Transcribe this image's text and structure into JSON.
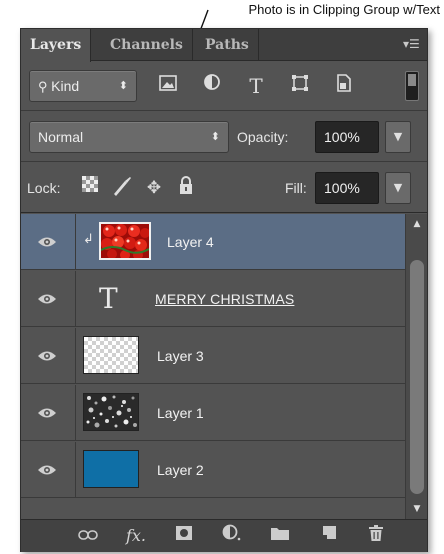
{
  "annotation": {
    "text": "Photo is in Clipping Group w/Text"
  },
  "tabs": [
    {
      "label": "Layers",
      "active": true
    },
    {
      "label": "Channels",
      "active": false
    },
    {
      "label": "Paths",
      "active": false
    }
  ],
  "filter": {
    "kind_label": "Kind",
    "icons": [
      "image-filter-icon",
      "adjustment-filter-icon",
      "type-filter-icon",
      "shape-filter-icon",
      "smart-object-filter-icon"
    ]
  },
  "blend": {
    "mode": "Normal",
    "opacity_label": "Opacity:",
    "opacity_value": "100%"
  },
  "lock": {
    "label": "Lock:",
    "fill_label": "Fill:",
    "fill_value": "100%",
    "icons": [
      "lock-transparent-icon",
      "lock-image-icon",
      "lock-position-icon",
      "lock-all-icon"
    ]
  },
  "layers": [
    {
      "name": "Layer 4",
      "type": "image",
      "selected": true,
      "clipped": true,
      "thumb": "red-ornaments"
    },
    {
      "name": "MERRY CHRISTMAS",
      "type": "text",
      "selected": false,
      "clipped": false
    },
    {
      "name": "Layer 3",
      "type": "image",
      "selected": false,
      "clipped": false,
      "thumb": "transparent"
    },
    {
      "name": "Layer 1",
      "type": "image",
      "selected": false,
      "clipped": false,
      "thumb": "noise"
    },
    {
      "name": "Layer 2",
      "type": "image",
      "selected": false,
      "clipped": false,
      "thumb": "blue"
    }
  ],
  "colors": {
    "panel": "#535353",
    "selected_row": "#5b6d85",
    "layer2_fill": "#0f6fa6",
    "ornament_red": "#c8160e"
  },
  "footer_icons": [
    "link-layers-icon",
    "fx-icon",
    "add-mask-icon",
    "adjustment-layer-icon",
    "new-group-icon",
    "new-layer-icon",
    "delete-layer-icon"
  ]
}
